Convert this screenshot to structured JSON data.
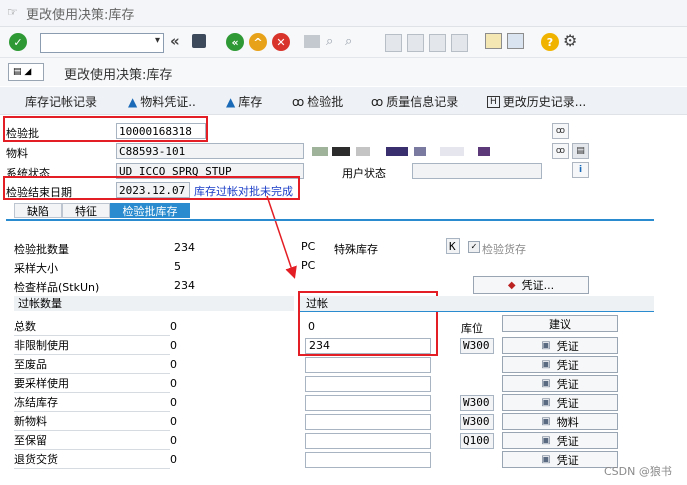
{
  "window": {
    "title": "更改使用决策:库存"
  },
  "screen": {
    "title": "更改使用决策:库存"
  },
  "toolbar": {
    "command_value": "",
    "dropdown_glyph": "▾",
    "icons": [
      "check-icon",
      "back-icon",
      "save-icon",
      "back-green-icon",
      "up-yellow-icon",
      "cancel-red-icon",
      "print-icon",
      "find-icon",
      "find-next-icon",
      "first-page-icon",
      "prev-page-icon",
      "next-page-icon",
      "last-page-icon",
      "new-session-icon",
      "layout-icon",
      "help-icon",
      "settings-icon"
    ]
  },
  "app_toolbar": {
    "buttons": [
      "库存记帐记录",
      "物料凭证..",
      "库存",
      "检验批",
      "质量信息记录",
      "更改历史记录..."
    ]
  },
  "header": {
    "inspection_lot_label": "检验批",
    "inspection_lot_value": "10000168318",
    "material_label": "物料",
    "material_value": "C88593-101",
    "system_status_label": "系统状态",
    "system_status_value": "UD   ICCO SPRQ STUP",
    "user_status_label": "用户状态",
    "inspection_end_date_label": "检验结束日期",
    "inspection_end_date_value": "2023.12.07",
    "annotation": "库存过帐对批未完成"
  },
  "tabs": [
    "缺陷",
    "特征",
    "检验批库存"
  ],
  "quantities": {
    "lot_qty_label": "检验批数量",
    "lot_qty_value": "234",
    "lot_qty_unit": "PC",
    "sample_size_label": "采样大小",
    "sample_size_value": "5",
    "sample_size_unit": "PC",
    "inspected_label": "检查样品(StkUn)",
    "inspected_value": "234",
    "special_stock_label": "特殊库存",
    "special_stock_value": "K",
    "inspection_stock_label": "检验货存",
    "document_button": "凭证..."
  },
  "posting": {
    "left_header": "过帐数量",
    "right_header": "过帐",
    "location_header": "库位",
    "proposal_header": "建议",
    "rows": [
      {
        "label": "总数",
        "qty": "0",
        "post": "0",
        "location": "",
        "action": ""
      },
      {
        "label": "非限制使用",
        "qty": "0",
        "post": "234",
        "location": "W300",
        "action": "凭证"
      },
      {
        "label": "至废品",
        "qty": "0",
        "post": "",
        "location": "",
        "action": "凭证"
      },
      {
        "label": "要采样使用",
        "qty": "0",
        "post": "",
        "location": "",
        "action": "凭证"
      },
      {
        "label": "冻结库存",
        "qty": "0",
        "post": "",
        "location": "W300",
        "action": "凭证"
      },
      {
        "label": "新物料",
        "qty": "0",
        "post": "",
        "location": "W300",
        "action": "物料"
      },
      {
        "label": "至保留",
        "qty": "0",
        "post": "",
        "location": "Q100",
        "action": "凭证"
      },
      {
        "label": "退货交货",
        "qty": "0",
        "post": "",
        "location": "",
        "action": "凭证"
      }
    ]
  },
  "watermark": "CSDN @狼书",
  "colors": {
    "accent": "#2a8ccf",
    "highlight": "#e31e24",
    "annotation": "#1a3cc7"
  }
}
